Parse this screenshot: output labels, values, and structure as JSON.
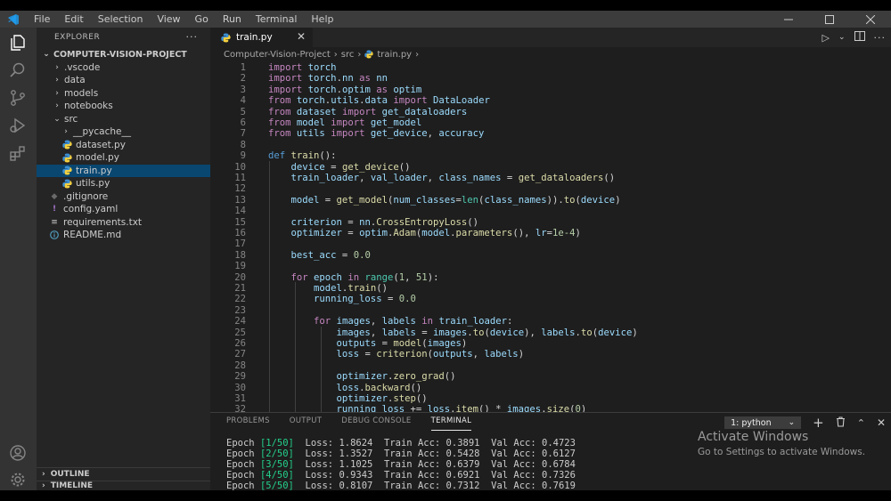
{
  "menu": [
    "File",
    "Edit",
    "Selection",
    "View",
    "Go",
    "Run",
    "Terminal",
    "Help"
  ],
  "sidebar": {
    "title": "EXPLORER",
    "more": "···",
    "project": "COMPUTER-VISION-PROJECT",
    "items": [
      {
        "label": ".vscode",
        "kind": "folder"
      },
      {
        "label": "data",
        "kind": "folder"
      },
      {
        "label": "models",
        "kind": "folder"
      },
      {
        "label": "notebooks",
        "kind": "folder"
      },
      {
        "label": "src",
        "kind": "folder-open"
      },
      {
        "label": "__pycache__",
        "kind": "folder"
      },
      {
        "label": "dataset.py",
        "kind": "python"
      },
      {
        "label": "model.py",
        "kind": "python"
      },
      {
        "label": "train.py",
        "kind": "python"
      },
      {
        "label": "utils.py",
        "kind": "python"
      },
      {
        "label": ".gitignore",
        "kind": "gitignore"
      },
      {
        "label": "config.yaml",
        "kind": "yaml"
      },
      {
        "label": "requirements.txt",
        "kind": "text"
      },
      {
        "label": "README.md",
        "kind": "info"
      }
    ],
    "outline": "OUTLINE",
    "timeline": "TIMELINE"
  },
  "editor": {
    "tab_label": "train.py",
    "tab_close": "✕",
    "breadcrumb": [
      "Computer-Vision-Project",
      "src",
      "train.py"
    ],
    "line_numbers": [
      "1",
      "2",
      "3",
      "4",
      "5",
      "6",
      "7",
      "8",
      "9",
      "10",
      "11",
      "12",
      "13",
      "14",
      "15",
      "16",
      "17",
      "18",
      "19",
      "20",
      "21",
      "22",
      "23",
      "24",
      "25",
      "26",
      "27",
      "28",
      "29",
      "30",
      "31",
      "32"
    ],
    "lines": [
      "import torch",
      "import torch.nn as nn",
      "import torch.optim as optim",
      "from torch.utils.data import DataLoader",
      "from dataset import get_dataloaders",
      "from model import get_model",
      "from utils import get_device, accuracy",
      "",
      "def train():",
      "    device = get_device()",
      "    train_loader, val_loader, class_names = get_dataloaders()",
      "",
      "    model = get_model(num_classes=len(class_names)).to(device)",
      "",
      "    criterion = nn.CrossEntropyLoss()",
      "    optimizer = optim.Adam(model.parameters(), lr=1e-4)",
      "",
      "    best_acc = 0.0",
      "",
      "    for epoch in range(1, 51):",
      "        model.train()",
      "        running_loss = 0.0",
      "",
      "        for images, labels in train_loader:",
      "            images, labels = images.to(device), labels.to(device)",
      "            outputs = model(images)",
      "            loss = criterion(outputs, labels)",
      "",
      "            optimizer.zero_grad()",
      "            loss.backward()",
      "            optimizer.step()",
      "            running_loss += loss.item() * images.size(0)"
    ]
  },
  "panel": {
    "tabs": [
      "PROBLEMS",
      "OUTPUT",
      "DEBUG CONSOLE",
      "TERMINAL"
    ],
    "active_tab": "TERMINAL",
    "terminal_select": "1: python",
    "terminal_lines": [
      {
        "epoch": "1/50",
        "loss": "1.8624",
        "train_acc": "0.3891",
        "val_acc": "0.4723"
      },
      {
        "epoch": "2/50",
        "loss": "1.3527",
        "train_acc": "0.5428",
        "val_acc": "0.6127"
      },
      {
        "epoch": "3/50",
        "loss": "1.1025",
        "train_acc": "0.6379",
        "val_acc": "0.6784"
      },
      {
        "epoch": "4/50",
        "loss": "0.9343",
        "train_acc": "0.6921",
        "val_acc": "0.7326"
      },
      {
        "epoch": "5/50",
        "loss": "0.8107",
        "train_acc": "0.7312",
        "val_acc": "0.7619"
      }
    ],
    "terminal_labels": {
      "epoch": "Epoch",
      "loss": "Loss:",
      "train": "Train Acc:",
      "val": "Val Acc:"
    }
  },
  "watermark": {
    "line1": "Activate Windows",
    "line2": "Go to Settings to activate Windows."
  },
  "colors": {
    "accent": "#007acc",
    "selection": "#094771",
    "python_icon": "#3b8fd4",
    "terminal_green": "#23d18b"
  }
}
